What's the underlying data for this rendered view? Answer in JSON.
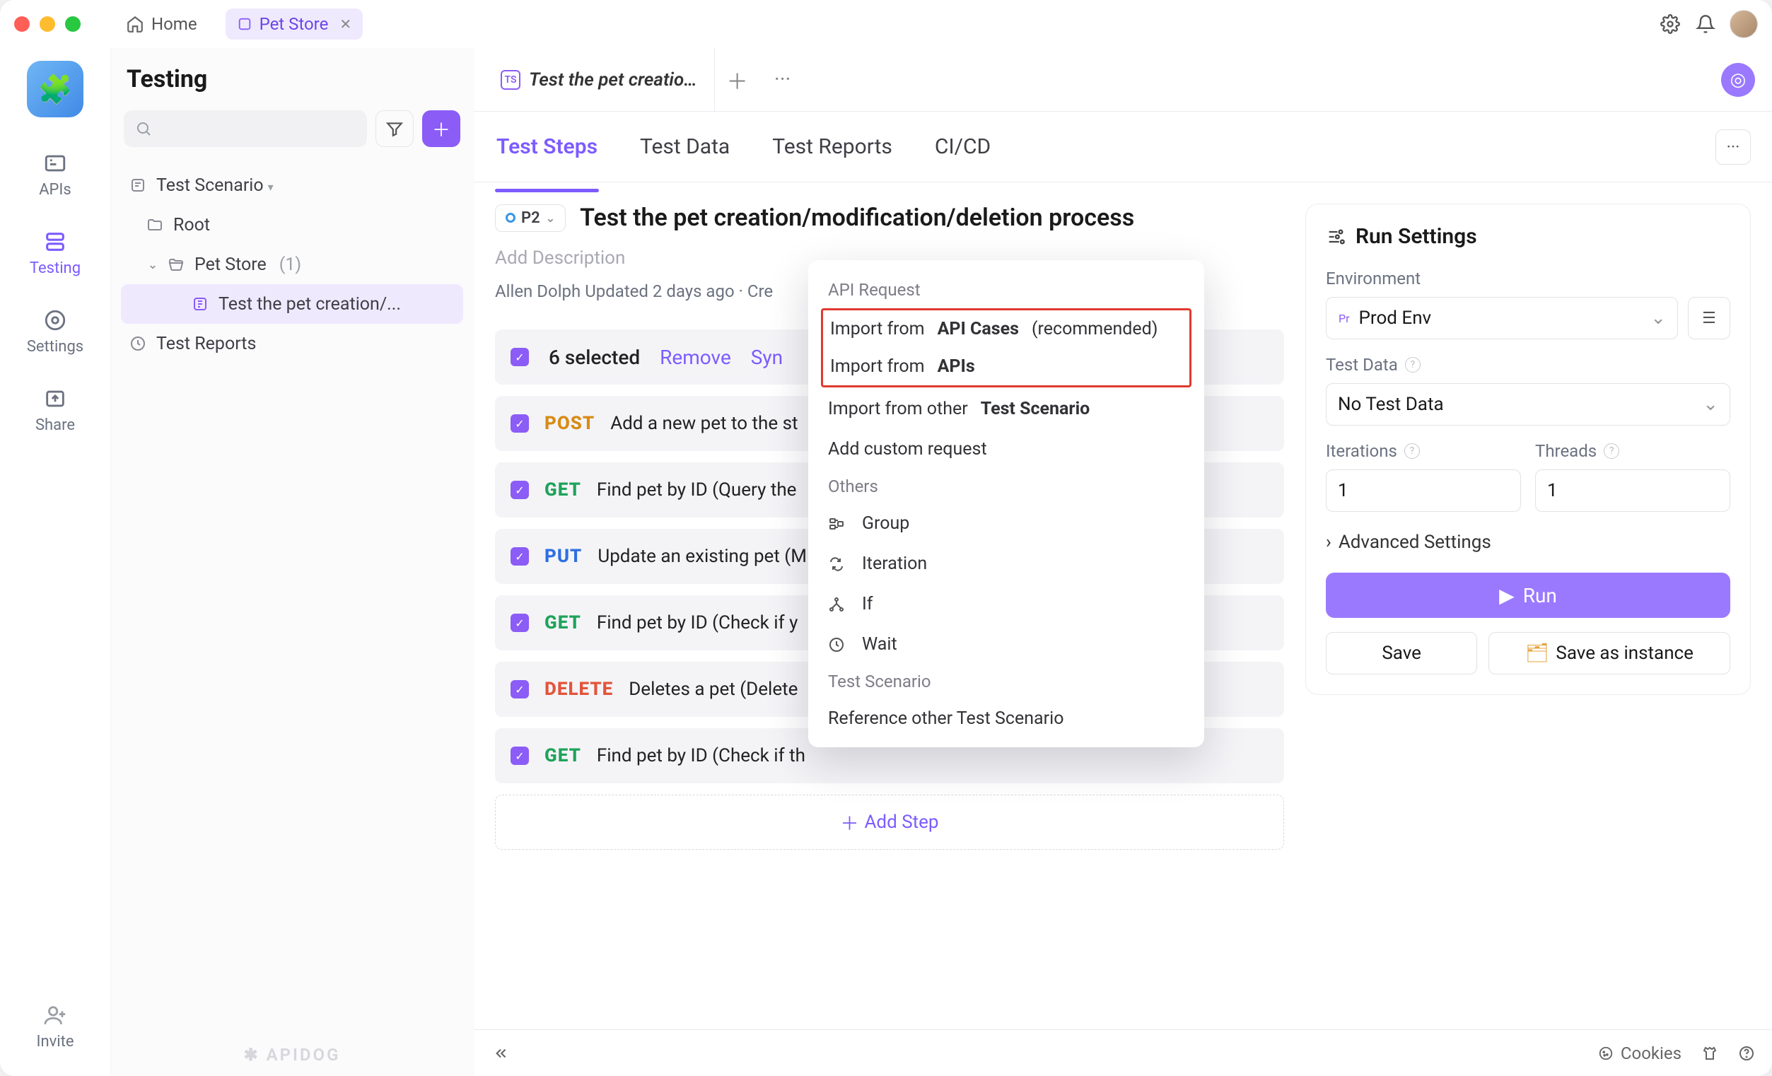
{
  "titlebar": {
    "home_label": "Home",
    "workspace_tab": "Pet Store"
  },
  "rail": {
    "items": [
      {
        "label": "APIs"
      },
      {
        "label": "Testing"
      },
      {
        "label": "Settings"
      },
      {
        "label": "Share"
      },
      {
        "label": "Invite"
      }
    ]
  },
  "sidebar": {
    "title": "Testing",
    "scenario_label": "Test Scenario",
    "root_label": "Root",
    "petstore_label": "Pet Store",
    "petstore_count": "(1)",
    "item_label": "Test the pet creation/...",
    "reports_label": "Test Reports",
    "footer_brand": "✱ APIDOG"
  },
  "main_tabs": {
    "active": "Test the pet creatio…"
  },
  "subtabs": {
    "items": [
      "Test Steps",
      "Test Data",
      "Test Reports",
      "CI/CD"
    ]
  },
  "scenario": {
    "priority": "P2",
    "title": "Test the pet creation/modification/deletion process",
    "add_desc": "Add Description",
    "author": "Allen Dolph",
    "updated": "Updated 2 days ago",
    "created_prefix": "Cre"
  },
  "selectbar": {
    "count_label": "6 selected",
    "remove": "Remove",
    "sync_prefix": "Syn"
  },
  "steps": [
    {
      "method": "POST",
      "cls": "m-post",
      "title": "Add a new pet to the st"
    },
    {
      "method": "GET",
      "cls": "m-get",
      "title": "Find pet by ID (Query the"
    },
    {
      "method": "PUT",
      "cls": "m-put",
      "title": "Update an existing pet (M"
    },
    {
      "method": "GET",
      "cls": "m-get",
      "title": "Find pet by ID (Check if y"
    },
    {
      "method": "DELETE",
      "cls": "m-delete",
      "title": "Deletes a pet (Delete"
    },
    {
      "method": "GET",
      "cls": "m-get",
      "title": "Find pet by ID (Check if th"
    }
  ],
  "add_step_label": "Add Step",
  "dropdown": {
    "section_api_request": "API Request",
    "import_api_cases_prefix": "Import from ",
    "import_api_cases_bold": "API Cases",
    "import_api_cases_suffix": " (recommended)",
    "import_apis_prefix": "Import from ",
    "import_apis_bold": "APIs",
    "import_other_prefix": "Import from other ",
    "import_other_bold": "Test Scenario",
    "add_custom": "Add custom request",
    "section_others": "Others",
    "group": "Group",
    "iteration": "Iteration",
    "if": "If",
    "wait": "Wait",
    "section_test_scenario": "Test Scenario",
    "ref_other": "Reference other Test Scenario"
  },
  "runpanel": {
    "title": "Run Settings",
    "env_label": "Environment",
    "env_badge": "Pr",
    "env_value": "Prod Env",
    "testdata_label": "Test Data",
    "testdata_value": "No Test Data",
    "iterations_label": "Iterations",
    "iterations_value": "1",
    "threads_label": "Threads",
    "threads_value": "1",
    "advanced": "Advanced Settings",
    "run": "Run",
    "save": "Save",
    "save_instance": "Save as instance"
  },
  "bottombar": {
    "cookies": "Cookies"
  }
}
